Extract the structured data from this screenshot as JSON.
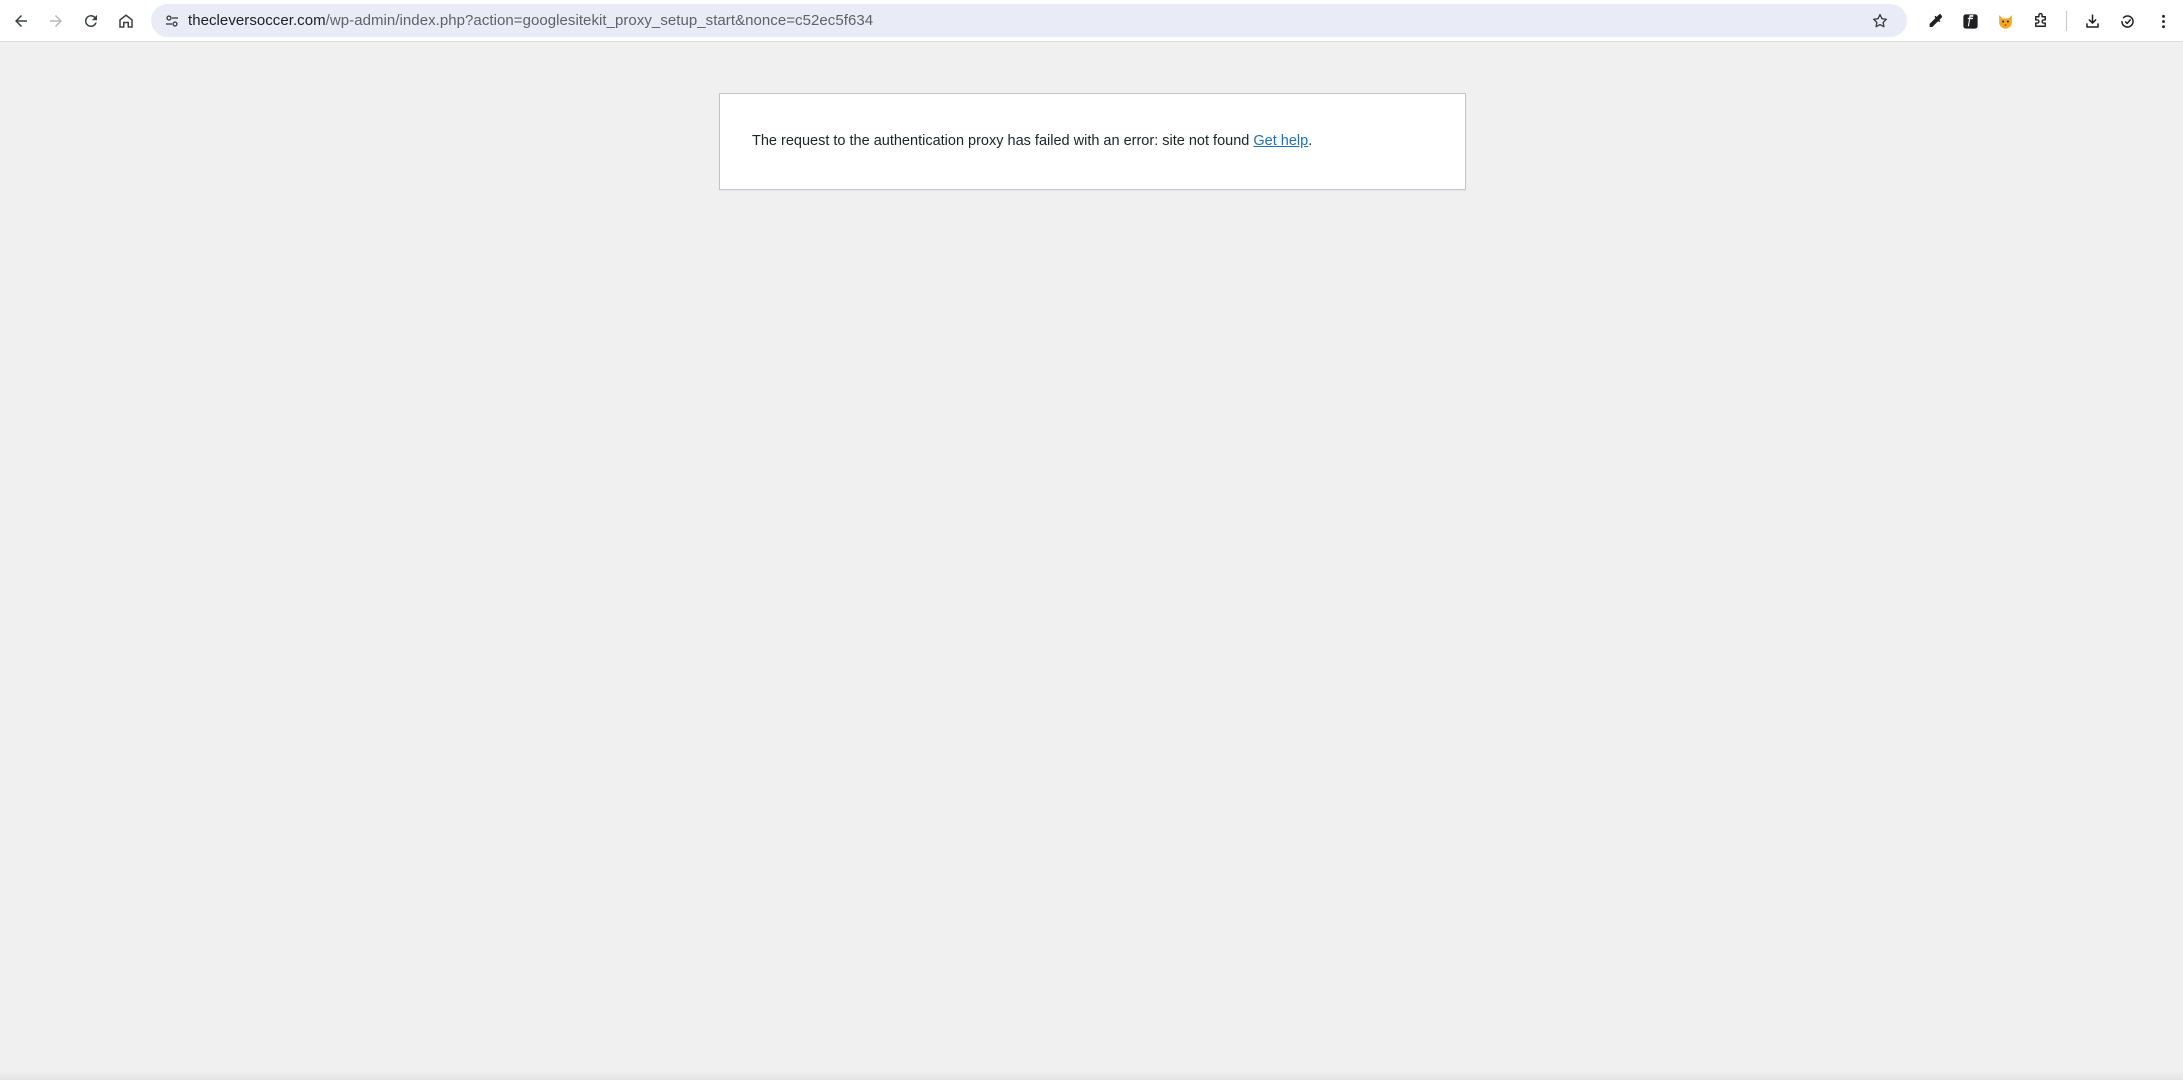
{
  "browser": {
    "url_host": "thecleversoccer.com",
    "url_path": "/wp-admin/index.php?action=googlesitekit_proxy_setup_start&nonce=c52ec5f634",
    "icons": {
      "back": "arrow-left-icon",
      "forward": "arrow-right-icon",
      "reload": "reload-icon",
      "home": "home-icon",
      "site_info": "tune-icon",
      "bookmark": "star-icon",
      "extensions": [
        "eyedropper-icon",
        "font-f-icon",
        "fox-icon",
        "puzzle-icon",
        "download-icon",
        "sync-icon",
        "kebab-menu-icon"
      ]
    }
  },
  "error": {
    "message": "The request to the authentication proxy has failed with an error: site not found ",
    "link_label": "Get help",
    "suffix": "."
  },
  "colors": {
    "page_background": "#f0f0f1",
    "link": "#2271b1",
    "omnibox": "#e9ebf6"
  }
}
